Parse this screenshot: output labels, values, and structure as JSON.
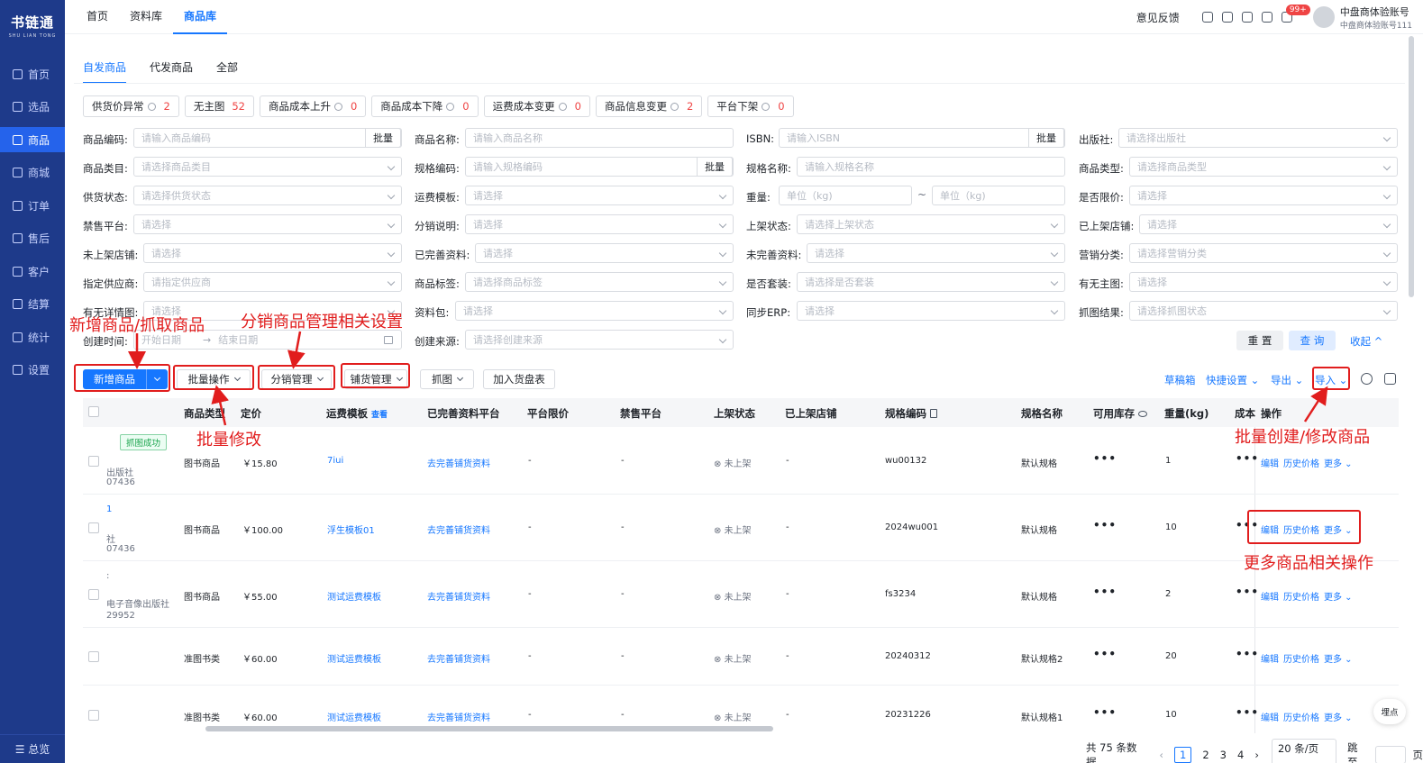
{
  "sidebar": {
    "logo_cn": "书链通",
    "logo_en": "SHU LIAN TONG",
    "items": [
      {
        "label": "首页"
      },
      {
        "label": "选品"
      },
      {
        "label": "商品"
      },
      {
        "label": "商城"
      },
      {
        "label": "订单"
      },
      {
        "label": "售后"
      },
      {
        "label": "客户"
      },
      {
        "label": "结算"
      },
      {
        "label": "统计"
      },
      {
        "label": "设置"
      }
    ],
    "active_index": 2,
    "footer": "☰ 总览"
  },
  "topnav": {
    "items": [
      {
        "label": "首页"
      },
      {
        "label": "资料库"
      },
      {
        "label": "商品库"
      }
    ],
    "active": "商品库"
  },
  "topright": {
    "feedback": "意见反馈",
    "badge": "99+",
    "account_name": "中盘商体验账号",
    "account_sub": "中盘商体验账号111"
  },
  "subtabs": [
    {
      "label": "自发商品"
    },
    {
      "label": "代发商品"
    },
    {
      "label": "全部"
    }
  ],
  "chips": [
    {
      "label": "供货价异常",
      "help": true,
      "count": "2"
    },
    {
      "label": "无主图",
      "help": false,
      "count": "52"
    },
    {
      "label": "商品成本上升",
      "help": true,
      "count": "0"
    },
    {
      "label": "商品成本下降",
      "help": true,
      "count": "0"
    },
    {
      "label": "运费成本变更",
      "help": true,
      "count": "0"
    },
    {
      "label": "商品信息变更",
      "help": true,
      "count": "2"
    },
    {
      "label": "平台下架",
      "help": true,
      "count": "0"
    }
  ],
  "filters": {
    "row1": [
      {
        "label": "商品编码:",
        "placeholder": "请输入商品编码",
        "batch": "批量"
      },
      {
        "label": "商品名称:",
        "placeholder": "请输入商品名称"
      },
      {
        "label": "ISBN:",
        "placeholder": "请输入ISBN",
        "batch": "批量"
      },
      {
        "label": "出版社:",
        "placeholder": "请选择出版社"
      }
    ],
    "row2": [
      {
        "label": "商品类目:",
        "placeholder": "请选择商品类目"
      },
      {
        "label": "规格编码:",
        "placeholder": "请输入规格编码",
        "batch": "批量"
      },
      {
        "label": "规格名称:",
        "placeholder": "请输入规格名称"
      },
      {
        "label": "商品类型:",
        "placeholder": "请选择商品类型"
      }
    ],
    "row3": [
      {
        "label": "供货状态:",
        "placeholder": "请选择供货状态"
      },
      {
        "label": "运费模板:",
        "placeholder": "请选择"
      },
      {
        "label": "重量:",
        "placeholder": "单位（kg)",
        "placeholder2": "单位（kg)",
        "sep": "~"
      },
      {
        "label": "是否限价:",
        "placeholder": "请选择"
      }
    ],
    "row4": [
      {
        "label": "禁售平台:",
        "placeholder": "请选择"
      },
      {
        "label": "分销说明:",
        "placeholder": "请选择"
      },
      {
        "label": "上架状态:",
        "placeholder": "请选择上架状态"
      },
      {
        "label": "已上架店铺:",
        "placeholder": "请选择"
      }
    ],
    "row5": [
      {
        "label": "未上架店铺:",
        "placeholder": "请选择"
      },
      {
        "label": "已完善资料:",
        "placeholder": "请选择"
      },
      {
        "label": "未完善资料:",
        "placeholder": "请选择"
      },
      {
        "label": "营销分类:",
        "placeholder": "请选择营销分类"
      }
    ],
    "row6": [
      {
        "label": "指定供应商:",
        "placeholder": "请指定供应商"
      },
      {
        "label": "商品标签:",
        "placeholder": "请选择商品标签"
      },
      {
        "label": "是否套装:",
        "placeholder": "请选择是否套装"
      },
      {
        "label": "有无主图:",
        "placeholder": "请选择"
      }
    ],
    "row7": [
      {
        "label": "有无详情图:",
        "placeholder": "请选择"
      },
      {
        "label": "资料包:",
        "placeholder": "请选择"
      },
      {
        "label": "同步ERP:",
        "placeholder": "请选择"
      },
      {
        "label": "抓图结果:",
        "placeholder": "请选择抓图状态"
      }
    ],
    "row8": [
      {
        "label": "创建时间:",
        "start": "开始日期",
        "arrow": "→",
        "end": "结束日期"
      },
      {
        "label": "创建来源:",
        "placeholder": "请选择创建来源"
      }
    ],
    "reset": "重 置",
    "query": "查 询",
    "collapse": "收起 ^"
  },
  "toolbar": {
    "new_product": "新增商品",
    "batch_ops": "批量操作",
    "dist_mgmt": "分销管理",
    "shop_mgmt": "铺货管理",
    "grab": "抓图",
    "add_to_list": "加入货盘表",
    "drafts": "草稿箱",
    "quick_settings": "快捷设置",
    "export": "导出",
    "import": "导入"
  },
  "table": {
    "headers": {
      "type": "商品类型",
      "price": "定价",
      "freight": "运费模板",
      "freight_view": "查看",
      "complete": "已完善资料平台",
      "limit": "平台限价",
      "banned": "禁售平台",
      "shelf": "上架状态",
      "shops": "已上架店铺",
      "sku": "规格编码",
      "spec": "规格名称",
      "stock": "可用库存",
      "weight": "重量(kg)",
      "cost": "成本",
      "ops": "操作"
    },
    "grab_tag": "抓图成功",
    "rows": [
      {
        "left1": "出版社",
        "left2": "07436",
        "type": "图书商品",
        "price": "￥15.80",
        "freight": "7iui",
        "complete": "去完善铺货资料",
        "limit": "-",
        "banned": "-",
        "shelf": "未上架",
        "shops": "-",
        "sku": "wu00132",
        "spec": "默认规格",
        "stock": "•••",
        "weight": "1",
        "cost": "•••"
      },
      {
        "left0": "1",
        "left1": "社",
        "left2": "07436",
        "type": "图书商品",
        "price": "￥100.00",
        "freight": "浮生模板01",
        "complete": "去完善铺货资料",
        "limit": "-",
        "banned": "-",
        "shelf": "未上架",
        "shops": "-",
        "sku": "2024wu001",
        "spec": "默认规格",
        "stock": "•••",
        "weight": "10",
        "cost": "•••"
      },
      {
        "left0": ":",
        "left1": "电子音像出版社",
        "left2": "29952",
        "type": "图书商品",
        "price": "￥55.00",
        "freight": "测试运费模板",
        "complete": "去完善铺货资料",
        "limit": "-",
        "banned": "-",
        "shelf": "未上架",
        "shops": "-",
        "sku": "fs3234",
        "spec": "默认规格",
        "stock": "•••",
        "weight": "2",
        "cost": "•••"
      },
      {
        "type": "准图书类",
        "price": "￥60.00",
        "freight": "测试运费模板",
        "complete": "去完善铺货资料",
        "limit": "-",
        "banned": "-",
        "shelf": "未上架",
        "shops": "-",
        "sku": "20240312",
        "spec": "默认规格2",
        "stock": "•••",
        "weight": "20",
        "cost": "•••"
      },
      {
        "type": "准图书类",
        "price": "￥60.00",
        "freight": "测试运费模板",
        "complete": "去完善铺货资料",
        "limit": "-",
        "banned": "-",
        "shelf": "未上架",
        "shops": "-",
        "sku": "20231226",
        "spec": "默认规格1",
        "stock": "•••",
        "weight": "10",
        "cost": "•••"
      }
    ],
    "ops": {
      "edit": "编辑",
      "history": "历史价格",
      "more": "更多"
    }
  },
  "pager": {
    "total": "共 75 条数据",
    "pages": [
      "1",
      "2",
      "3",
      "4"
    ],
    "current": "1",
    "page_size": "20 条/页",
    "jump": "跳至",
    "page_unit": "页"
  },
  "fab": "埋点",
  "annotations": {
    "new_product": "新增商品/抓取商品",
    "dist": "分销商品管理相关设置",
    "batch": "批量修改",
    "import": "批量创建/修改商品",
    "more": "更多商品相关操作"
  }
}
